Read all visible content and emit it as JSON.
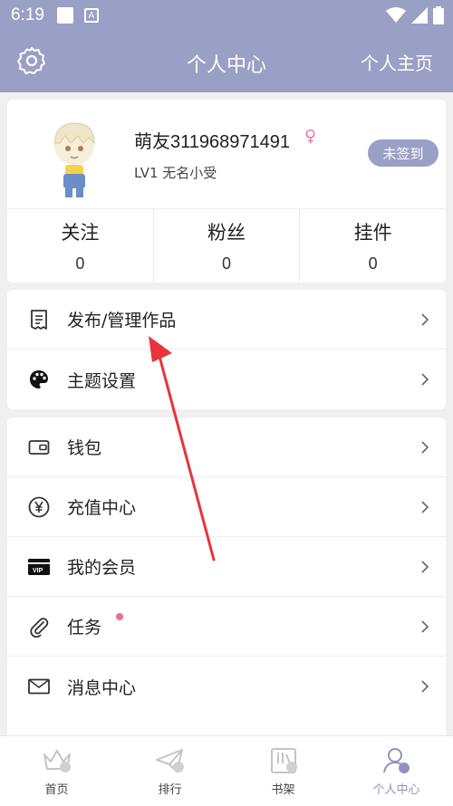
{
  "status_bar": {
    "time": "6:19",
    "a_icon": "A"
  },
  "header": {
    "title": "个人中心",
    "homepage_link": "个人主页",
    "settings_icon": "gear-icon"
  },
  "profile": {
    "nickname": "萌友311968971491",
    "gender_symbol": "♀",
    "level": "LV1 无名小受",
    "sign_button": "未签到",
    "stats": [
      {
        "label": "关注",
        "value": "0"
      },
      {
        "label": "粉丝",
        "value": "0"
      },
      {
        "label": "挂件",
        "value": "0"
      }
    ]
  },
  "menu_group1": [
    {
      "label": "发布/管理作品",
      "icon": "document-icon"
    },
    {
      "label": "主题设置",
      "icon": "palette-icon"
    }
  ],
  "menu_group2": [
    {
      "label": "钱包",
      "icon": "wallet-icon"
    },
    {
      "label": "充值中心",
      "icon": "yen-icon"
    },
    {
      "label": "我的会员",
      "icon": "vip-icon"
    },
    {
      "label": "任务",
      "icon": "paperclip-icon"
    },
    {
      "label": "消息中心",
      "icon": "mail-icon"
    }
  ],
  "tabbar": [
    {
      "label": "首页",
      "icon": "crown-icon"
    },
    {
      "label": "排行",
      "icon": "paper-plane-icon"
    },
    {
      "label": "书架",
      "icon": "bookshelf-icon"
    },
    {
      "label": "个人中心",
      "icon": "person-icon",
      "active": true
    }
  ],
  "colors": {
    "accent": "#9a9fc5",
    "badge_dot": "#ef6c8c",
    "female": "#e87aa0",
    "arrow": "#e8343a"
  }
}
